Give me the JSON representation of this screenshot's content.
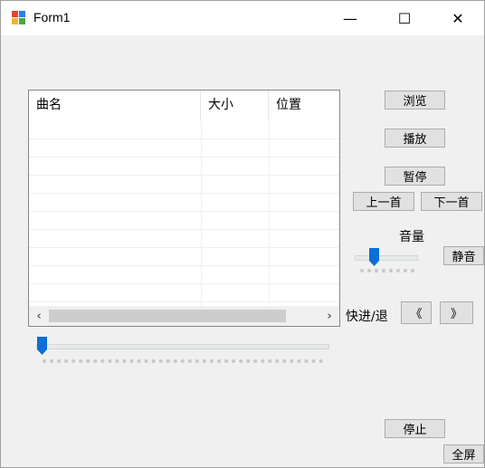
{
  "window": {
    "title": "Form1"
  },
  "titlebar": {
    "minimize": "—",
    "maximize": "☐",
    "close": "✕"
  },
  "listview": {
    "columns": [
      "曲名",
      "大小",
      "位置"
    ],
    "scroll_left": "‹",
    "scroll_right": "›"
  },
  "buttons": {
    "browse": "浏览",
    "play": "播放",
    "pause": "暂停",
    "prev": "上一首",
    "next": "下一首",
    "mute": "静音",
    "rewind": "《",
    "forward": "》",
    "stop": "停止",
    "fullscreen": "全屏"
  },
  "labels": {
    "volume": "音量",
    "seek": "快进/退"
  },
  "colors": {
    "accent": "#0a6fd6",
    "window_bg": "#f0f0f0"
  },
  "sliders": {
    "volume": {
      "value": 0.2
    },
    "progress": {
      "value": 0.0
    }
  }
}
